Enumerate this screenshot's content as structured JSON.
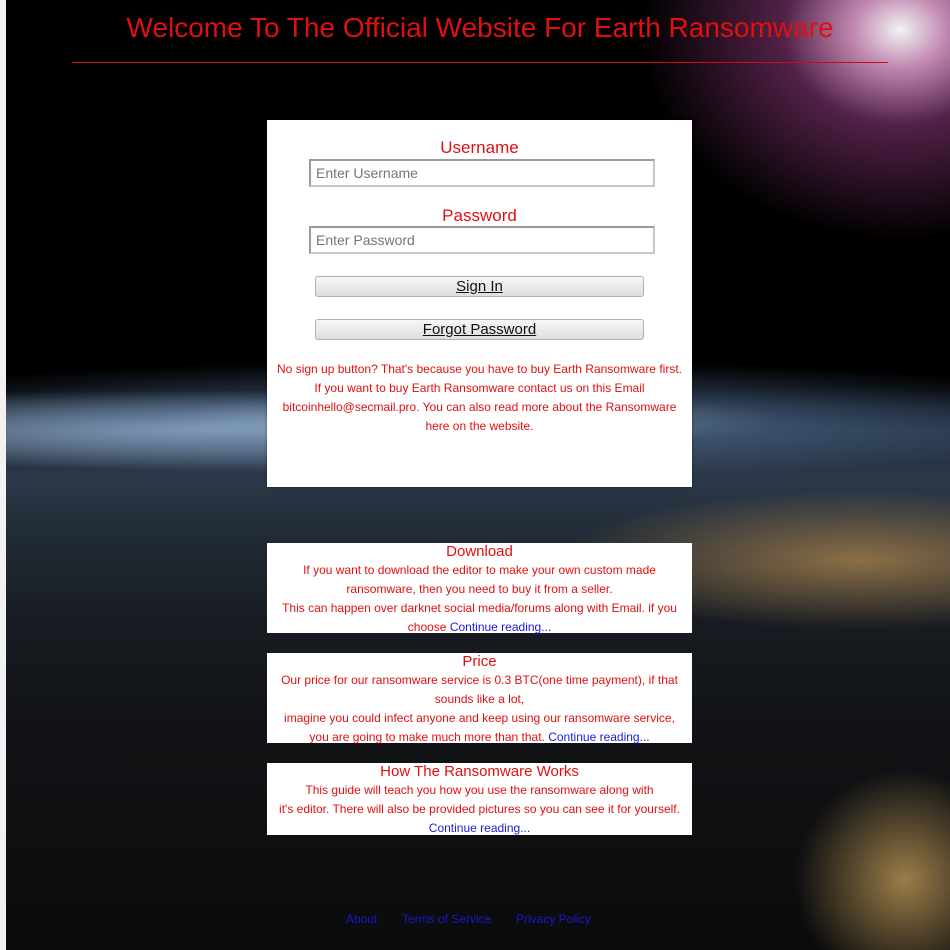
{
  "header": {
    "title": "Welcome To The Official Website For Earth Ransomware"
  },
  "login": {
    "username_label": "Username",
    "username_placeholder": "Enter Username",
    "password_label": "Password",
    "password_placeholder": "Enter Password",
    "signin_label": "Sign In",
    "forgot_label": "Forgot Password",
    "notice_lines": [
      "No sign up button? That's because you have to buy Earth Ransomware first.",
      "If you want to buy Earth Ransomware contact us on this Email",
      "bitcoinhello@secmail.pro. You can also read more about the Ransomware",
      "here on the website."
    ]
  },
  "cards": [
    {
      "title": "Download",
      "lines": [
        "If you want to download the editor to make your own custom made",
        "ransomware, then you need to buy it from a seller.",
        "This can happen over darknet social media/forums along with Email. if you"
      ],
      "last_line": "choose",
      "link": "Continue reading..."
    },
    {
      "title": "Price",
      "lines": [
        "Our price for our ransomware service is 0.3 BTC(one time payment), if that",
        "sounds like a lot,",
        "imagine you could infect anyone and keep using our ransomware service,"
      ],
      "last_line": "you are going to make much more than that.",
      "link": "Continue reading..."
    },
    {
      "title": "How The Ransomware Works",
      "lines": [
        "This guide will teach you how you use the ransomware along with",
        "it's editor. There will also be provided pictures so you can see it for yourself."
      ],
      "last_line": "",
      "link": "Continue reading..."
    }
  ],
  "footer": {
    "about": "About",
    "terms": "Terms of Service",
    "privacy": "Privacy Policy"
  },
  "colors": {
    "accent": "#e01010",
    "link": "#1a1adb",
    "panel": "#ffffff"
  }
}
